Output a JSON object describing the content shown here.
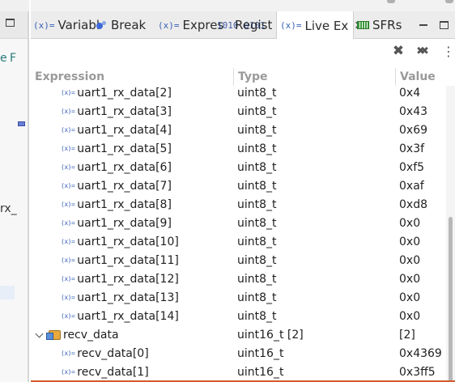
{
  "left_panel": {
    "fragment_e": "e",
    "fragment_f": "F",
    "fragment_rx": "rx_"
  },
  "tabs": [
    {
      "label": "Variabl",
      "icon": "variable-icon"
    },
    {
      "label": "Break",
      "icon": "breakpoints-icon"
    },
    {
      "label": "Expres",
      "icon": "expressions-icon"
    },
    {
      "label": "Regist",
      "icon": "registers-icon"
    },
    {
      "label": "Live Ex",
      "icon": "live-expressions-icon",
      "active": true
    },
    {
      "label": "SFRs",
      "icon": "sfrs-icon"
    }
  ],
  "icons": {
    "variable": "(x)=",
    "registers": "1010 0101",
    "close": "✕",
    "remove": "✖",
    "remove_all": "✖✖",
    "more": "⋮"
  },
  "table": {
    "columns": [
      "Expression",
      "Type",
      "Value"
    ],
    "rows": [
      {
        "expression": "uart1_rx_data[2]",
        "type": "uint8_t",
        "value": "0x4",
        "kind": "child"
      },
      {
        "expression": "uart1_rx_data[3]",
        "type": "uint8_t",
        "value": "0x43",
        "kind": "child"
      },
      {
        "expression": "uart1_rx_data[4]",
        "type": "uint8_t",
        "value": "0x69",
        "kind": "child"
      },
      {
        "expression": "uart1_rx_data[5]",
        "type": "uint8_t",
        "value": "0x3f",
        "kind": "child"
      },
      {
        "expression": "uart1_rx_data[6]",
        "type": "uint8_t",
        "value": "0xf5",
        "kind": "child"
      },
      {
        "expression": "uart1_rx_data[7]",
        "type": "uint8_t",
        "value": "0xaf",
        "kind": "child"
      },
      {
        "expression": "uart1_rx_data[8]",
        "type": "uint8_t",
        "value": "0xd8",
        "kind": "child"
      },
      {
        "expression": "uart1_rx_data[9]",
        "type": "uint8_t",
        "value": "0x0",
        "kind": "child"
      },
      {
        "expression": "uart1_rx_data[10]",
        "type": "uint8_t",
        "value": "0x0",
        "kind": "child"
      },
      {
        "expression": "uart1_rx_data[11]",
        "type": "uint8_t",
        "value": "0x0",
        "kind": "child"
      },
      {
        "expression": "uart1_rx_data[12]",
        "type": "uint8_t",
        "value": "0x0",
        "kind": "child"
      },
      {
        "expression": "uart1_rx_data[13]",
        "type": "uint8_t",
        "value": "0x0",
        "kind": "child"
      },
      {
        "expression": "uart1_rx_data[14]",
        "type": "uint8_t",
        "value": "0x0",
        "kind": "child"
      },
      {
        "expression": "recv_data",
        "type": "uint16_t [2]",
        "value": "[2]",
        "kind": "parent"
      },
      {
        "expression": "recv_data[0]",
        "type": "uint16_t",
        "value": "0x4369",
        "kind": "child"
      },
      {
        "expression": "recv_data[1]",
        "type": "uint16_t",
        "value": "0x3ff5",
        "kind": "child"
      }
    ]
  },
  "colors": {
    "accent": "#d55b2b",
    "icon_blue": "#3a62b5"
  }
}
